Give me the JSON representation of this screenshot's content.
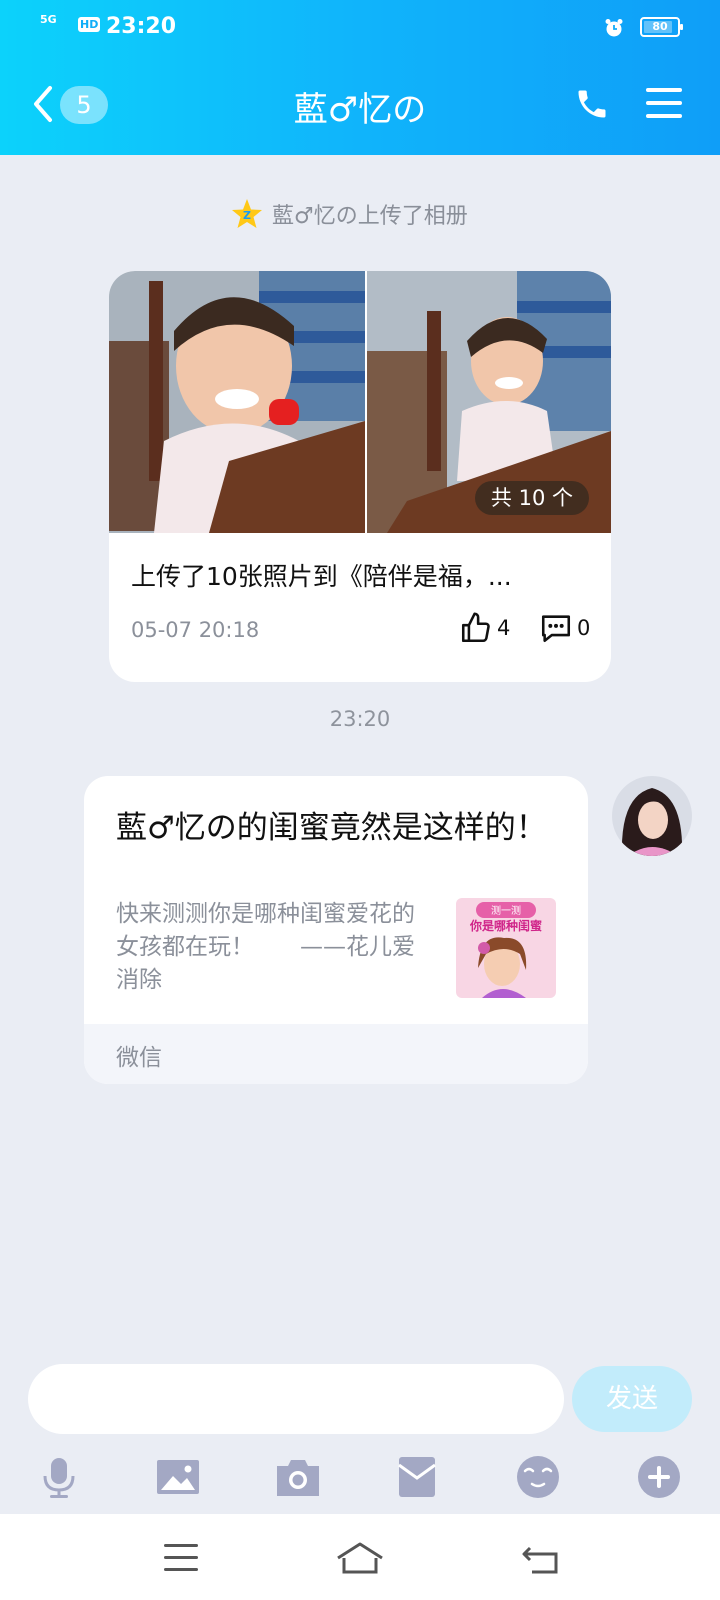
{
  "status_bar": {
    "signal": "5G",
    "hd": "HD",
    "time": "23:20",
    "battery": "80"
  },
  "header": {
    "unread_count": "5",
    "title": "藍♂忆の"
  },
  "notice": {
    "text": "藍♂忆の上传了相册"
  },
  "album_card": {
    "photo_count_label": "共 10 个",
    "title": "上传了10张照片到《陪伴是福，...",
    "date": "05-07 20:18",
    "likes": "4",
    "comments": "0"
  },
  "timestamp": "23:20",
  "share_card": {
    "title": "藍♂忆の的闺蜜竟然是这样的！",
    "description": "快来测测你是哪种闺蜜爱花的女孩都在玩！　　——花儿爱消除",
    "thumbnail_text_top": "测一测",
    "thumbnail_text_main": "你是哪种闺蜜",
    "source": "微信"
  },
  "composer": {
    "input_value": "",
    "send_label": "发送"
  },
  "toolbar": {
    "icons": [
      "microphone-icon",
      "image-icon",
      "camera-icon",
      "red-packet-icon",
      "emoji-icon",
      "plus-icon"
    ]
  },
  "colors": {
    "header_gradient_start": "#0cd2fb",
    "header_gradient_end": "#0f9ef8",
    "background": "#eaedf4",
    "send_button": "#c2ecfb",
    "tool_icon": "#a3a8c4"
  }
}
